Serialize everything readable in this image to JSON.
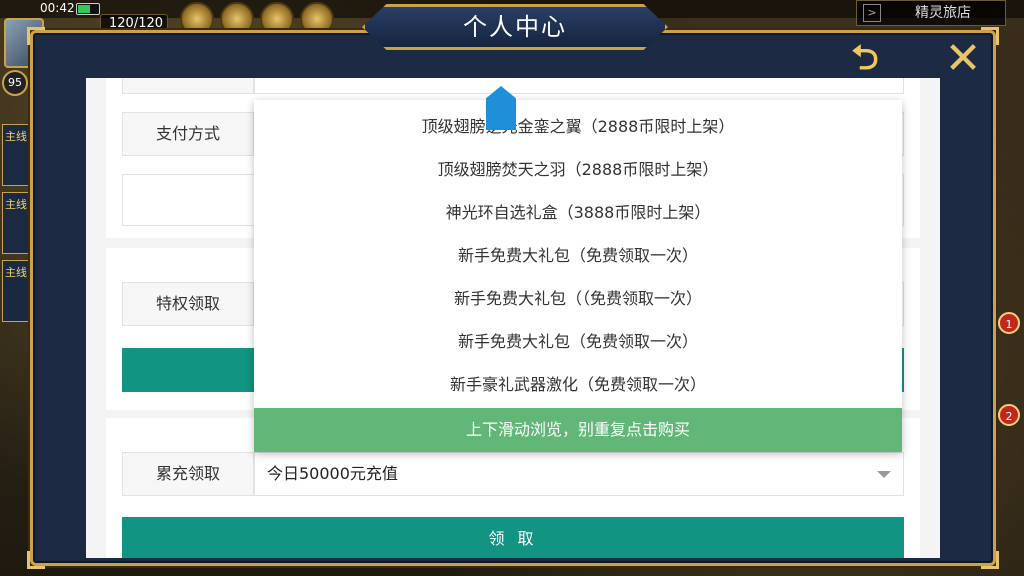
{
  "status": {
    "time": "00:42",
    "battery_level": 0.6
  },
  "hud": {
    "energy": "120/120",
    "level": "95"
  },
  "shop": {
    "label": "精灵旅店"
  },
  "quest_tabs": [
    "主线",
    "主线",
    "主线"
  ],
  "badges": [
    "1",
    "2"
  ],
  "modal": {
    "title": "个人中心"
  },
  "form": {
    "top_field_value": "",
    "payment_label": "支付方式",
    "privilege_label": "特权领取",
    "cumulative_label": "累充领取",
    "cumulative_value": "今日50000元充值",
    "claim_button": "领 取"
  },
  "dropdown": {
    "items": [
      "顶级翅膀逆光金銮之翼（2888币限时上架）",
      "顶级翅膀焚天之羽（2888币限时上架）",
      "神光环自选礼盒（3888币限时上架）",
      "新手免费大礼包（免费领取一次）",
      "新手免费大礼包（（免费领取一次）",
      "新手免费大礼包（免费领取一次）",
      "新手豪礼武器激化（免费领取一次）"
    ],
    "hint": "上下滑动浏览，别重复点击购买"
  },
  "colors": {
    "teal": "#129482",
    "hint_green": "#62b778",
    "gold": "#c9a24a",
    "frame": "#1c2a44"
  }
}
